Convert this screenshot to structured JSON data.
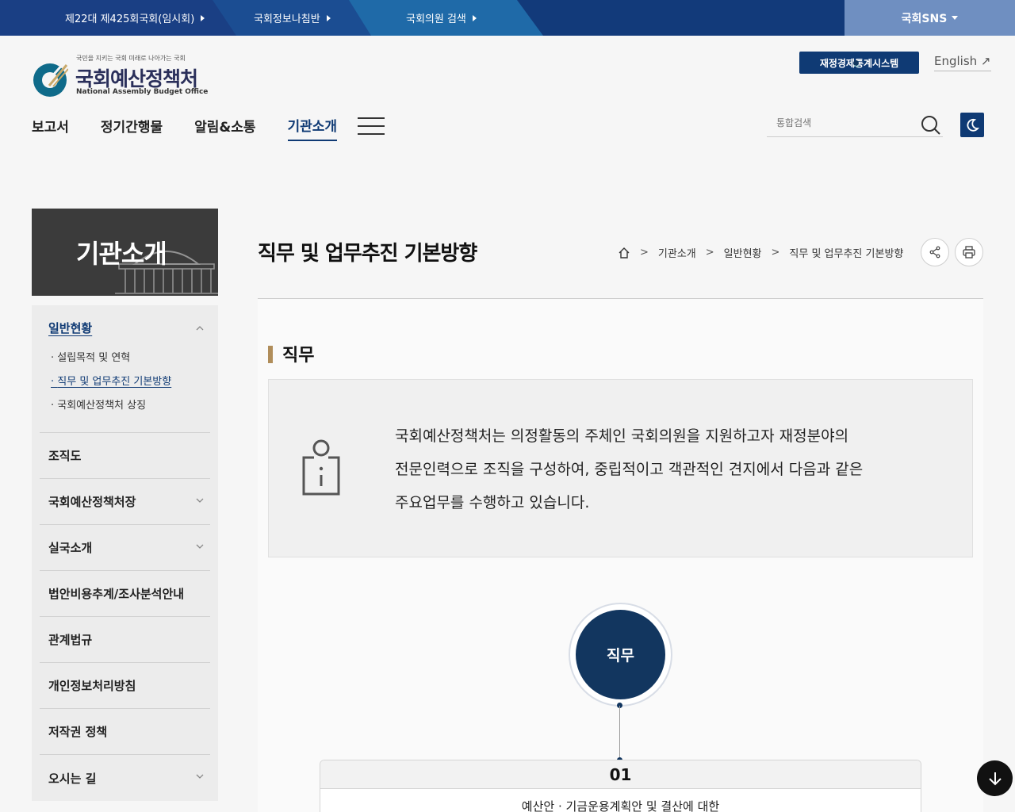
{
  "topbar": {
    "links": [
      "제22대 제425회국회(임시회)",
      "국회정보나침반",
      "국회의원 검색"
    ],
    "sns_label": "국회SNS"
  },
  "logo": {
    "slogan": "국민을 지키는 국회 미래로 나아가는 국회",
    "name": "국회예산정책처",
    "english": "National Assembly Budget Office"
  },
  "header": {
    "fiscal_button": "재정경제통계시스템",
    "english_link": "English ↗",
    "search_placeholder": "통합검색"
  },
  "nav": {
    "items": [
      "보고서",
      "정기간행물",
      "알림&소통",
      "기관소개"
    ],
    "active": "기관소개"
  },
  "sidebar": {
    "banner_title": "기관소개",
    "first": {
      "label": "일반현황",
      "subs": [
        "설립목적 및 연혁",
        "직무 및 업무추진 기본방향",
        "국회예산정책처 상징"
      ]
    },
    "items": [
      "조직도",
      "국회예산정책처장",
      "실국소개",
      "법안비용추계/조사분석안내",
      "관계법규",
      "개인정보처리방침",
      "저작권 정책",
      "오시는 길"
    ]
  },
  "content": {
    "page_title": "직무 및 업무추진 기본방향",
    "breadcrumb": [
      "기관소개",
      "일반현황",
      "직무 및 업무추진 기본방향"
    ],
    "section_title": "직무",
    "info_lines": [
      "국회예산정책처는 의정활동의 주체인 국회의원을 지원하고자 재정분야의",
      "전문인력으로 조직을 구성하여, 중립적이고 객관적인 견지에서 다음과 같은",
      "주요업무를 수행하고 있습니다."
    ],
    "circle_label": "직무",
    "card_number": "01",
    "card_text": "예산안 · 기금운용계획안 및 결산에 대한"
  },
  "colors": {
    "primary": "#0f3a74",
    "topbar": "#123a7a",
    "accent": "#b08d5a"
  }
}
